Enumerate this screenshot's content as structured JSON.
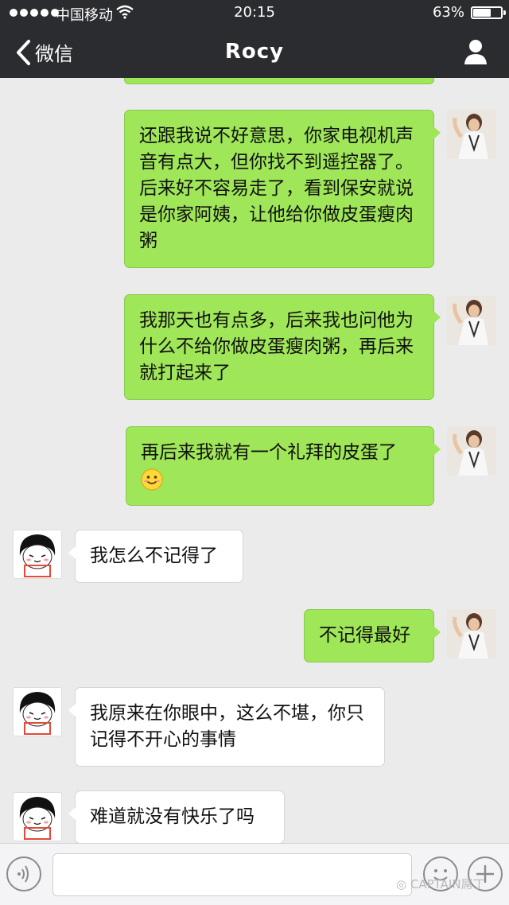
{
  "status_bar": {
    "carrier": "中国移动",
    "time": "20:15",
    "battery": "63%"
  },
  "nav": {
    "back_label": "微信",
    "title": "Rocy"
  },
  "messages": [
    {
      "from": "me",
      "text": "还跟我说不好意思，你家电视机声音有点大，但你找不到遥控器了。后来好不容易走了，看到保安就说是你家阿姨，让他给你做皮蛋瘦肉粥"
    },
    {
      "from": "me",
      "text": "我那天也有点多，后来我也问他为什么不给你做皮蛋瘦肉粥，再后来就打起来了"
    },
    {
      "from": "me",
      "text": "再后来我就有一个礼拜的皮蛋了",
      "emoji": "smile-emoji"
    },
    {
      "from": "her",
      "text": "我怎么不记得了"
    },
    {
      "from": "me",
      "text": "不记得最好"
    },
    {
      "from": "her",
      "text": "我原来在你眼中，这么不堪，你只记得不开心的事情"
    },
    {
      "from": "her",
      "text": "难道就没有快乐了吗"
    }
  ],
  "input": {
    "value": "",
    "placeholder": ""
  },
  "watermark": "CAPTAIN屌丁",
  "colors": {
    "nav_bg": "#2b2c30",
    "my_bubble": "#9fe658",
    "her_bubble": "#ffffff",
    "chat_bg": "#ebebeb"
  }
}
